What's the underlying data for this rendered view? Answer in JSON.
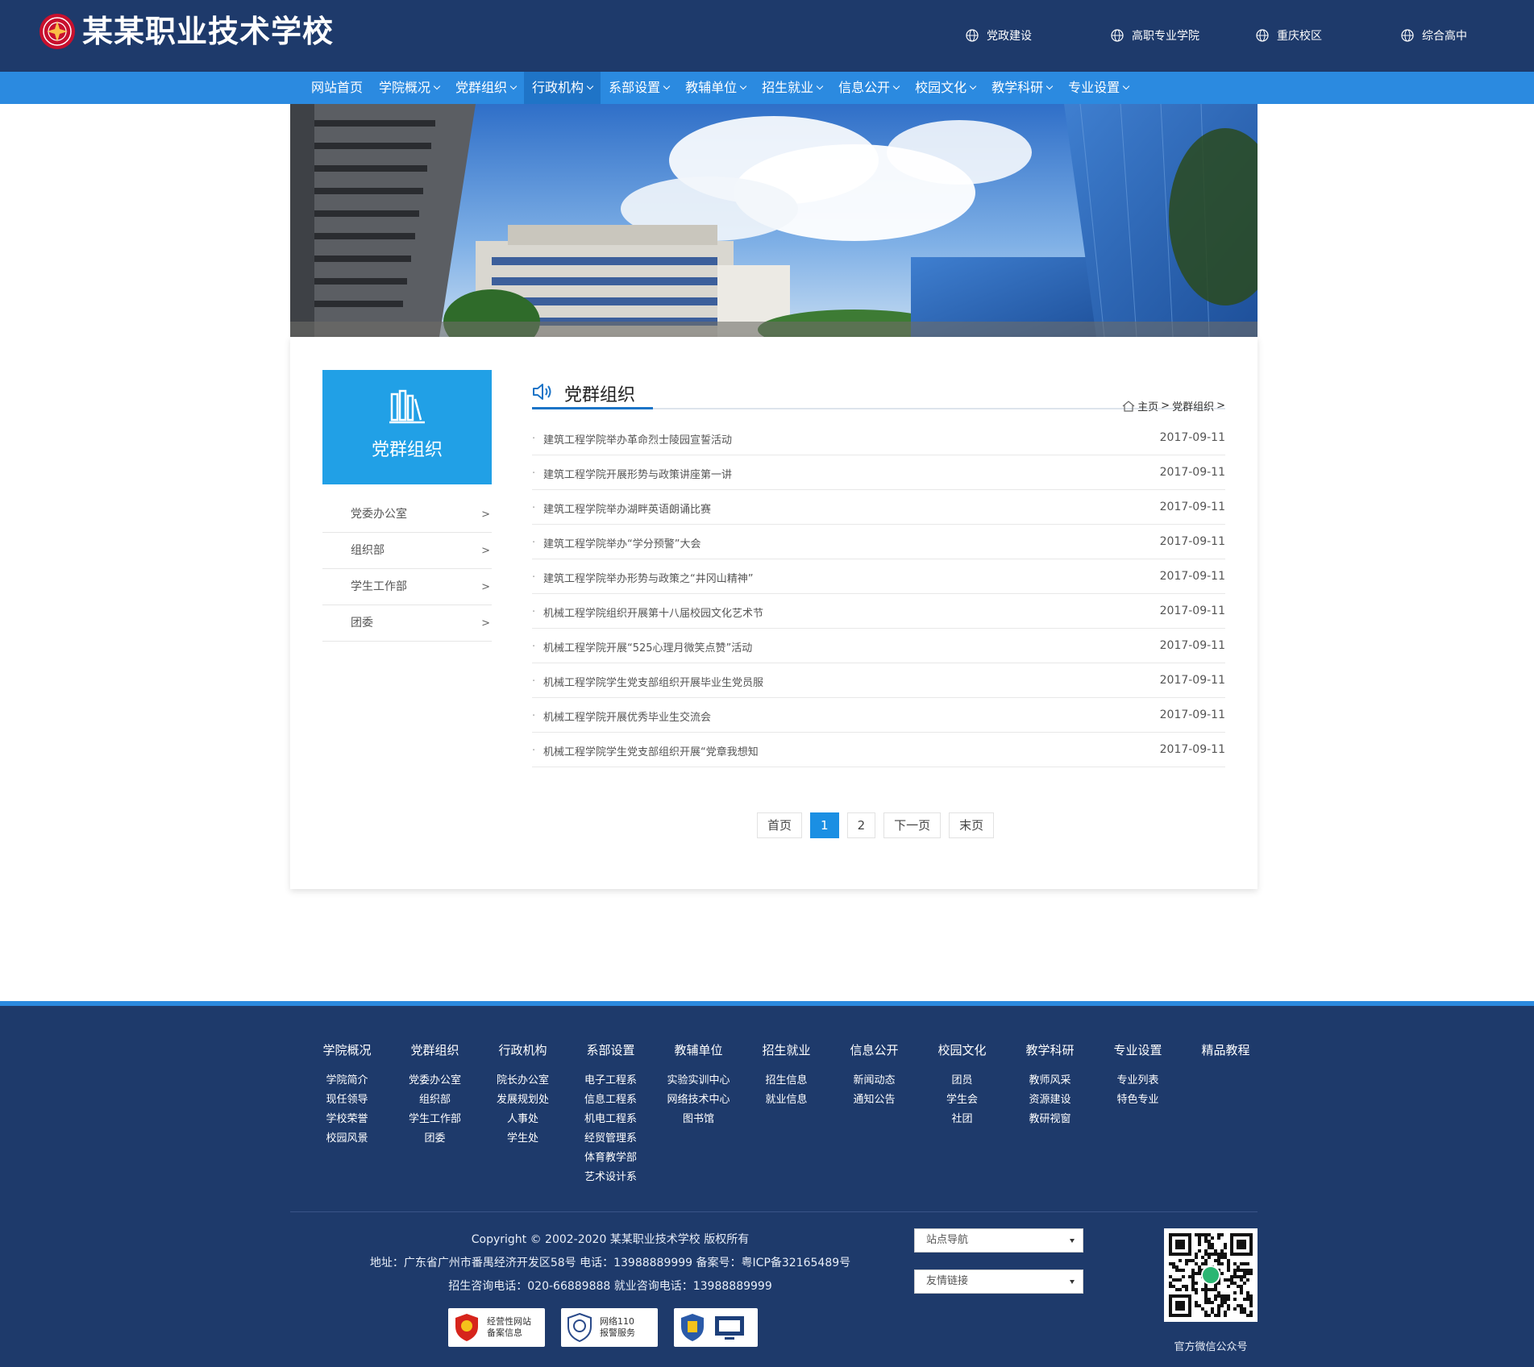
{
  "header": {
    "school_name": "某某职业技术学校",
    "links": [
      {
        "label": "党政建设"
      },
      {
        "label": "高职专业学院"
      },
      {
        "label": "重庆校区"
      },
      {
        "label": "综合高中"
      }
    ]
  },
  "nav": {
    "items": [
      {
        "label": "网站首页"
      },
      {
        "label": "学院概况"
      },
      {
        "label": "党群组织"
      },
      {
        "label": "行政机构"
      },
      {
        "label": "系部设置"
      },
      {
        "label": "教辅单位"
      },
      {
        "label": "招生就业"
      },
      {
        "label": "信息公开"
      },
      {
        "label": "校园文化"
      },
      {
        "label": "教学科研"
      },
      {
        "label": "专业设置"
      }
    ]
  },
  "sidebar": {
    "title": "党群组织",
    "arrow": ">",
    "items": [
      {
        "label": "党委办公室"
      },
      {
        "label": "组织部"
      },
      {
        "label": "学生工作部"
      },
      {
        "label": "团委"
      }
    ]
  },
  "main": {
    "title": "党群组织",
    "breadcrumb": {
      "home": "主页",
      "sep": ">",
      "current": "党群组织",
      "tail": ">"
    },
    "bullet": "·",
    "articles": [
      {
        "title": "建筑工程学院举办革命烈士陵园宣誓活动",
        "date": "2017-09-11"
      },
      {
        "title": "建筑工程学院开展形势与政策讲座第一讲",
        "date": "2017-09-11"
      },
      {
        "title": "建筑工程学院举办湖畔英语朗诵比赛",
        "date": "2017-09-11"
      },
      {
        "title": "建筑工程学院举办“学分预警”大会",
        "date": "2017-09-11"
      },
      {
        "title": "建筑工程学院举办形势与政策之“井冈山精神”",
        "date": "2017-09-11"
      },
      {
        "title": "机械工程学院组织开展第十八届校园文化艺术节",
        "date": "2017-09-11"
      },
      {
        "title": "机械工程学院开展“525心理月微笑点赞”活动",
        "date": "2017-09-11"
      },
      {
        "title": "机械工程学院学生党支部组织开展毕业生党员服",
        "date": "2017-09-11"
      },
      {
        "title": "机械工程学院开展优秀毕业生交流会",
        "date": "2017-09-11"
      },
      {
        "title": "机械工程学院学生党支部组织开展“党章我想知",
        "date": "2017-09-11"
      }
    ]
  },
  "pagination": {
    "first": "首页",
    "pages": [
      "1",
      "2"
    ],
    "current": "1",
    "next": "下一页",
    "last": "末页"
  },
  "footer": {
    "columns": [
      {
        "heading": "学院概况",
        "items": [
          "学院简介",
          "现任领导",
          "学校荣誉",
          "校园风景"
        ]
      },
      {
        "heading": "党群组织",
        "items": [
          "党委办公室",
          "组织部",
          "学生工作部",
          "团委"
        ]
      },
      {
        "heading": "行政机构",
        "items": [
          "院长办公室",
          "发展规划处",
          "人事处",
          "学生处"
        ]
      },
      {
        "heading": "系部设置",
        "items": [
          "电子工程系",
          "信息工程系",
          "机电工程系",
          "经贸管理系",
          "体育教学部",
          "艺术设计系"
        ]
      },
      {
        "heading": "教辅单位",
        "items": [
          "实验实训中心",
          "网络技术中心",
          "图书馆"
        ]
      },
      {
        "heading": "招生就业",
        "items": [
          "招生信息",
          "就业信息"
        ]
      },
      {
        "heading": "信息公开",
        "items": [
          "新闻动态",
          "通知公告"
        ]
      },
      {
        "heading": "校园文化",
        "items": [
          "团员",
          "学生会",
          "社团"
        ]
      },
      {
        "heading": "教学科研",
        "items": [
          "教师风采",
          "资源建设",
          "教研视窗"
        ]
      },
      {
        "heading": "专业设置",
        "items": [
          "专业列表",
          "特色专业"
        ]
      },
      {
        "heading": "精品教程",
        "items": []
      }
    ],
    "copyright": "Copyright © 2002-2020 某某职业技术学校 版权所有",
    "address": "地址：广东省广州市番禺经济开发区58号 电话：13988889999 备案号：粤ICP备32165489号",
    "phones": "招生咨询电话：020-66889888 就业咨询电话：13988889999",
    "badges": [
      {
        "line1": "经营性网站",
        "line2": "备案信息"
      },
      {
        "line1": "网络110",
        "line2": "报警服务"
      },
      {
        "line1": "",
        "line2": ""
      }
    ],
    "site_nav_select": "站点导航",
    "links_select": "友情链接",
    "qr_label": "官方微信公众号"
  },
  "colors": {
    "header_bg": "#1e3a6b",
    "nav_bg": "#2b8ae0",
    "accent": "#21a0e6",
    "pager_current": "#1b8fe3"
  }
}
